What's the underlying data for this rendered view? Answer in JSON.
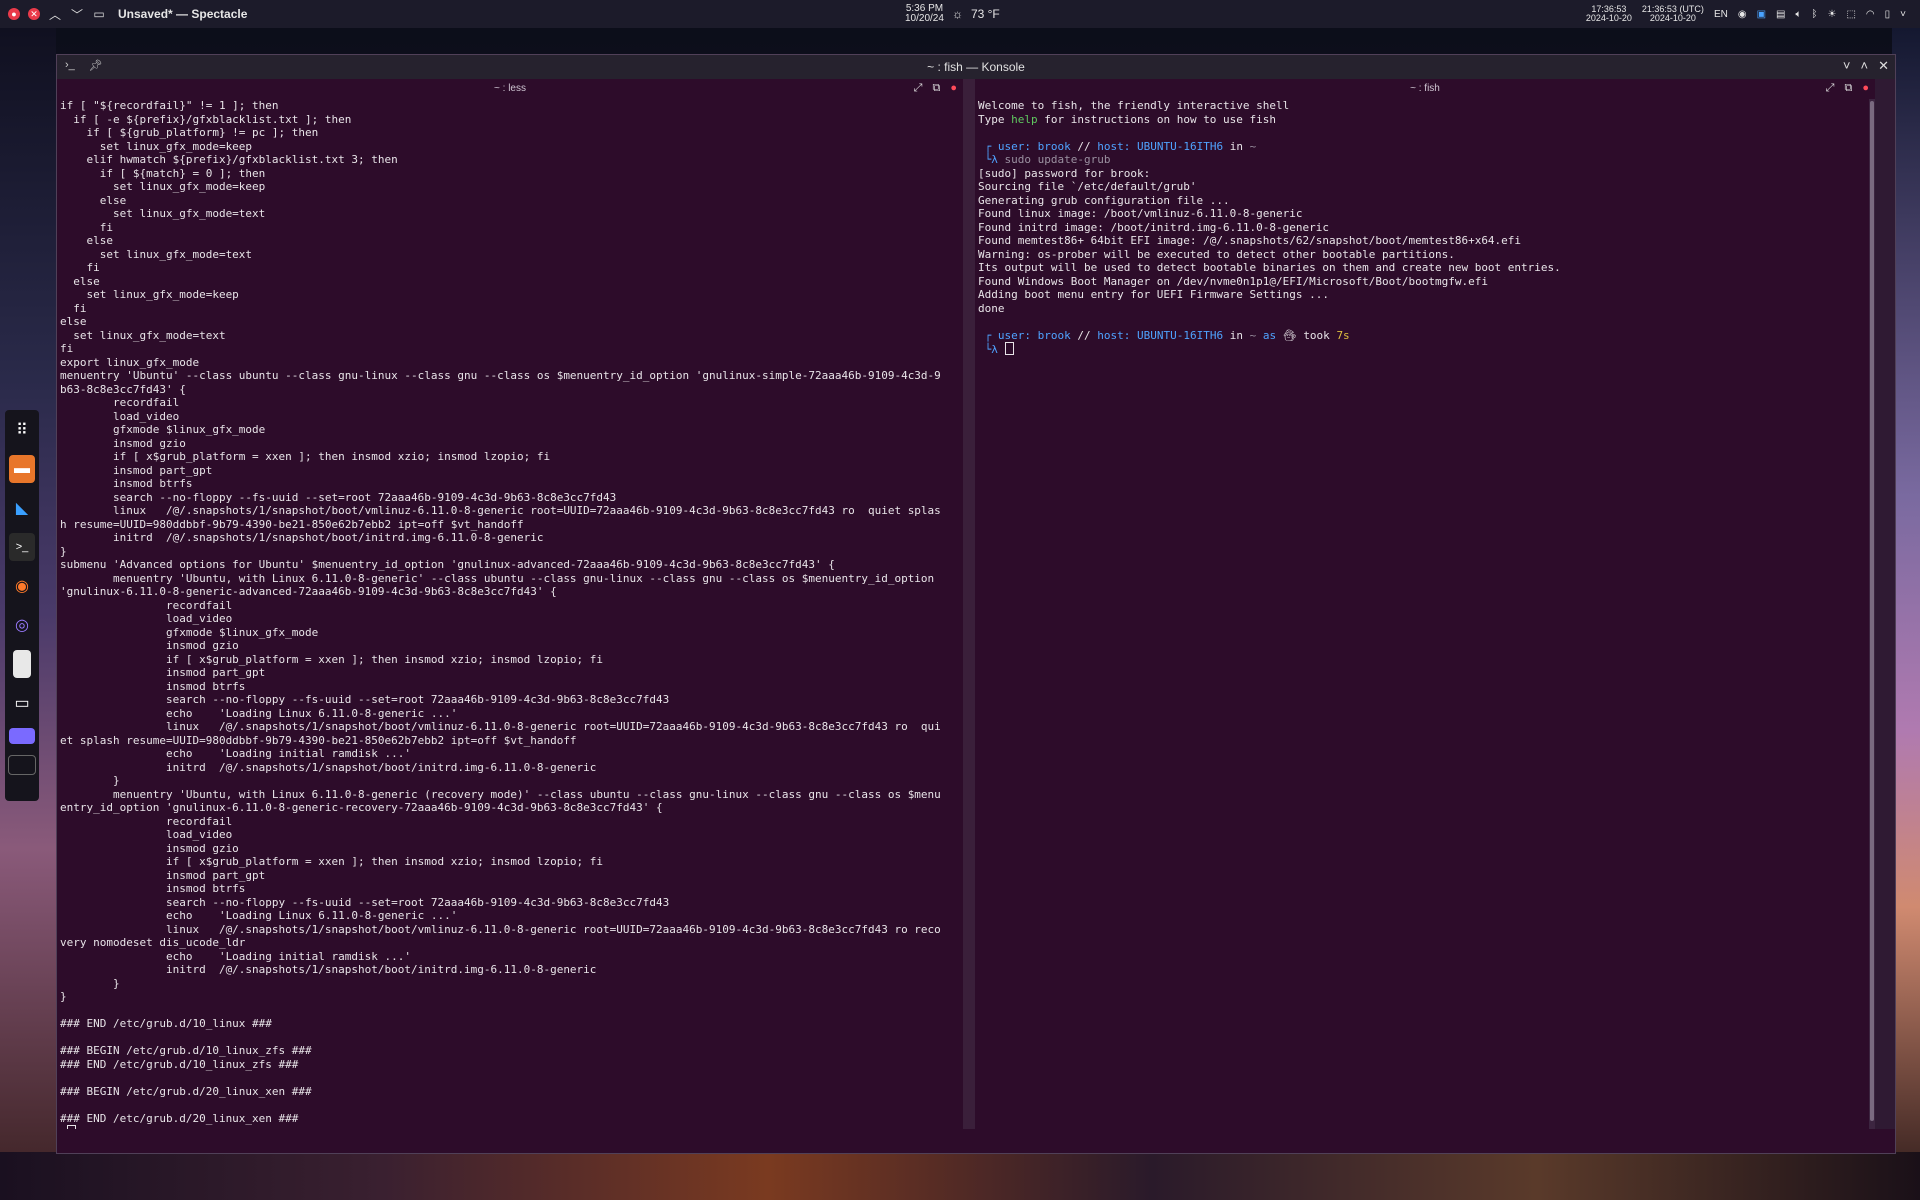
{
  "top_panel": {
    "window_title": "Unsaved* — Spectacle",
    "clock_time": "5:36 PM",
    "clock_date": "10/20/24",
    "weather": "73 °F",
    "tz_local_time": "17:36:53",
    "tz_local_date": "2024-10-20",
    "tz_utc_time": "21:36:53 (UTC)",
    "tz_utc_date": "2024-10-20",
    "lang": "EN"
  },
  "konsole": {
    "title": "~ : fish — Konsole",
    "left_pane": {
      "title": "~ : less",
      "lines": [
        "if [ \"${recordfail}\" != 1 ]; then",
        "  if [ -e ${prefix}/gfxblacklist.txt ]; then",
        "    if [ ${grub_platform} != pc ]; then",
        "      set linux_gfx_mode=keep",
        "    elif hwmatch ${prefix}/gfxblacklist.txt 3; then",
        "      if [ ${match} = 0 ]; then",
        "        set linux_gfx_mode=keep",
        "      else",
        "        set linux_gfx_mode=text",
        "      fi",
        "    else",
        "      set linux_gfx_mode=text",
        "    fi",
        "  else",
        "    set linux_gfx_mode=keep",
        "  fi",
        "else",
        "  set linux_gfx_mode=text",
        "fi",
        "export linux_gfx_mode",
        "menuentry 'Ubuntu' --class ubuntu --class gnu-linux --class gnu --class os $menuentry_id_option 'gnulinux-simple-72aaa46b-9109-4c3d-9",
        "b63-8c8e3cc7fd43' {",
        "        recordfail",
        "        load_video",
        "        gfxmode $linux_gfx_mode",
        "        insmod gzio",
        "        if [ x$grub_platform = xxen ]; then insmod xzio; insmod lzopio; fi",
        "        insmod part_gpt",
        "        insmod btrfs",
        "        search --no-floppy --fs-uuid --set=root 72aaa46b-9109-4c3d-9b63-8c8e3cc7fd43",
        "        linux   /@/.snapshots/1/snapshot/boot/vmlinuz-6.11.0-8-generic root=UUID=72aaa46b-9109-4c3d-9b63-8c8e3cc7fd43 ro  quiet splas",
        "h resume=UUID=980ddbbf-9b79-4390-be21-850e62b7ebb2 ipt=off $vt_handoff",
        "        initrd  /@/.snapshots/1/snapshot/boot/initrd.img-6.11.0-8-generic",
        "}",
        "submenu 'Advanced options for Ubuntu' $menuentry_id_option 'gnulinux-advanced-72aaa46b-9109-4c3d-9b63-8c8e3cc7fd43' {",
        "        menuentry 'Ubuntu, with Linux 6.11.0-8-generic' --class ubuntu --class gnu-linux --class gnu --class os $menuentry_id_option",
        "'gnulinux-6.11.0-8-generic-advanced-72aaa46b-9109-4c3d-9b63-8c8e3cc7fd43' {",
        "                recordfail",
        "                load_video",
        "                gfxmode $linux_gfx_mode",
        "                insmod gzio",
        "                if [ x$grub_platform = xxen ]; then insmod xzio; insmod lzopio; fi",
        "                insmod part_gpt",
        "                insmod btrfs",
        "                search --no-floppy --fs-uuid --set=root 72aaa46b-9109-4c3d-9b63-8c8e3cc7fd43",
        "                echo    'Loading Linux 6.11.0-8-generic ...'",
        "                linux   /@/.snapshots/1/snapshot/boot/vmlinuz-6.11.0-8-generic root=UUID=72aaa46b-9109-4c3d-9b63-8c8e3cc7fd43 ro  qui",
        "et splash resume=UUID=980ddbbf-9b79-4390-be21-850e62b7ebb2 ipt=off $vt_handoff",
        "                echo    'Loading initial ramdisk ...'",
        "                initrd  /@/.snapshots/1/snapshot/boot/initrd.img-6.11.0-8-generic",
        "        }",
        "        menuentry 'Ubuntu, with Linux 6.11.0-8-generic (recovery mode)' --class ubuntu --class gnu-linux --class gnu --class os $menu",
        "entry_id_option 'gnulinux-6.11.0-8-generic-recovery-72aaa46b-9109-4c3d-9b63-8c8e3cc7fd43' {",
        "                recordfail",
        "                load_video",
        "                insmod gzio",
        "                if [ x$grub_platform = xxen ]; then insmod xzio; insmod lzopio; fi",
        "                insmod part_gpt",
        "                insmod btrfs",
        "                search --no-floppy --fs-uuid --set=root 72aaa46b-9109-4c3d-9b63-8c8e3cc7fd43",
        "                echo    'Loading Linux 6.11.0-8-generic ...'",
        "                linux   /@/.snapshots/1/snapshot/boot/vmlinuz-6.11.0-8-generic root=UUID=72aaa46b-9109-4c3d-9b63-8c8e3cc7fd43 ro reco",
        "very nomodeset dis_ucode_ldr",
        "                echo    'Loading initial ramdisk ...'",
        "                initrd  /@/.snapshots/1/snapshot/boot/initrd.img-6.11.0-8-generic",
        "        }",
        "}",
        "",
        "### END /etc/grub.d/10_linux ###",
        "",
        "### BEGIN /etc/grub.d/10_linux_zfs ###",
        "### END /etc/grub.d/10_linux_zfs ###",
        "",
        "### BEGIN /etc/grub.d/20_linux_xen ###",
        "",
        "### END /etc/grub.d/20_linux_xen ###"
      ],
      "less_prompt": ":"
    },
    "right_pane": {
      "title": "~ : fish",
      "welcome": "Welcome to fish, the friendly interactive shell",
      "help_pre": "Type ",
      "help_word": "help",
      "help_post": " for instructions on how to use fish",
      "prompt_user_label": "user:",
      "prompt_user": "brook",
      "prompt_sep": "//",
      "prompt_host_label": "host:",
      "prompt_host": "UBUNTU-16ITH6",
      "prompt_in": "in",
      "prompt_dir": "~",
      "command": "sudo update-grub",
      "output": [
        "[sudo] password for brook:",
        "Sourcing file `/etc/default/grub'",
        "Generating grub configuration file ...",
        "Found linux image: /boot/vmlinuz-6.11.0-8-generic",
        "Found initrd image: /boot/initrd.img-6.11.0-8-generic",
        "Found memtest86+ 64bit EFI image: /@/.snapshots/62/snapshot/boot/memtest86+x64.efi",
        "Warning: os-prober will be executed to detect other bootable partitions.",
        "Its output will be used to detect bootable binaries on them and create new boot entries.",
        "Found Windows Boot Manager on /dev/nvme0n1p1@/EFI/Microsoft/Boot/bootmgfw.efi",
        "Adding boot menu entry for UEFI Firmware Settings ...",
        "done"
      ],
      "prompt2_as": "as",
      "prompt2_took": "took",
      "prompt2_time": "7s"
    }
  },
  "colors": {
    "terminal_bg": "#2d0c2a",
    "prompt_blue": "#4fa3ff",
    "accent_red": "#e93a4a"
  }
}
